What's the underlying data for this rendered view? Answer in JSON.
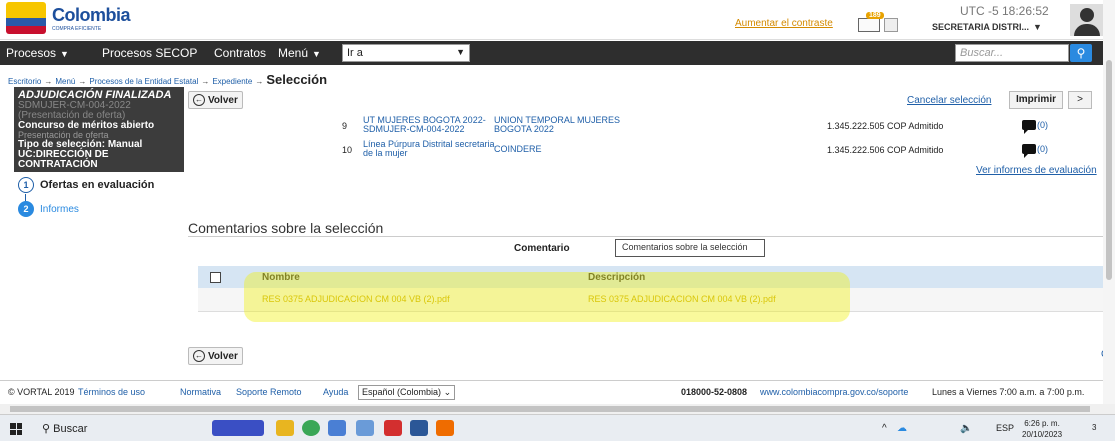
{
  "header": {
    "logo_title": "Colombia",
    "logo_sub": "COMPRA EFICIENTE",
    "contrast_link": "Aumentar el contraste",
    "mail_count": "189",
    "utc": "UTC -5 18:26:52",
    "user": "SECRETARIA DISTRI..."
  },
  "nav": {
    "items": [
      "Procesos",
      "Procesos SECOP",
      "Contratos",
      "Menú"
    ],
    "goto_value": "Ir a",
    "search_placeholder": "Buscar..."
  },
  "breadcrumb": {
    "items": [
      "Escritorio",
      "Menú",
      "Procesos de la Entidad Estatal",
      "Expediente"
    ],
    "current": "Selección"
  },
  "sidebar": {
    "status": "ADJUDICACIÓN FINALIZADA",
    "process_id": "SDMUJER-CM-004-2022",
    "phase": "(Presentación de oferta)",
    "type": "Concurso de méritos abierto",
    "phase2": "Presentación de oferta",
    "selection_type": "Tipo de selección: Manual",
    "uc": "UC:DIRECCIÓN DE CONTRATACIÓN",
    "steps": [
      {
        "num": "1",
        "label": "Ofertas en evaluación"
      },
      {
        "num": "2",
        "label": "Informes"
      }
    ]
  },
  "toolbar": {
    "volver": "Volver",
    "cancel": "Cancelar selección",
    "print": "Imprimir",
    "next": ">"
  },
  "offers": [
    {
      "num": "9",
      "process": "UT MUJERES BOGOTA 2022- SDMUJER-CM-004-2022",
      "provider": "UNION TEMPORAL MUJERES BOGOTA 2022",
      "value": "1.345.222.505 COP Admitido",
      "comments": "(0)"
    },
    {
      "num": "10",
      "process": "Línea Púrpura Distrital secretaria de la mujer",
      "provider": "COINDERE",
      "value": "1.345.222.506 COP Admitido",
      "comments": "(0)"
    }
  ],
  "ver_informes": "Ver informes de evaluación",
  "comments_section": {
    "title": "Comentarios sobre la selección",
    "label": "Comentario",
    "input_value": "Comentarios sobre la selección"
  },
  "documents": {
    "headers": [
      "Nombre",
      "Descripción"
    ],
    "rows": [
      {
        "name": "RES 0375 ADJUDICACION CM 004 VB (2).pdf",
        "description": "RES 0375 ADJUDICACION CM 004 VB (2).pdf"
      }
    ]
  },
  "bottom": {
    "volver": "Volver",
    "right_partial": "C"
  },
  "footer": {
    "copyright": "© VORTAL 2019",
    "links": [
      "Términos de uso",
      "Normativa",
      "Soporte Remoto",
      "Ayuda"
    ],
    "language": "Español (Colombia)",
    "phone": "018000-52-0808",
    "support_url": "www.colombiacompra.gov.co/soporte",
    "hours": "Lunes a Viernes 7:00 a.m. a 7:00 p.m."
  },
  "taskbar": {
    "search": "Buscar",
    "lang": "ESP",
    "time": "6:26 p. m.",
    "date": "20/10/2023",
    "notif": "3"
  }
}
